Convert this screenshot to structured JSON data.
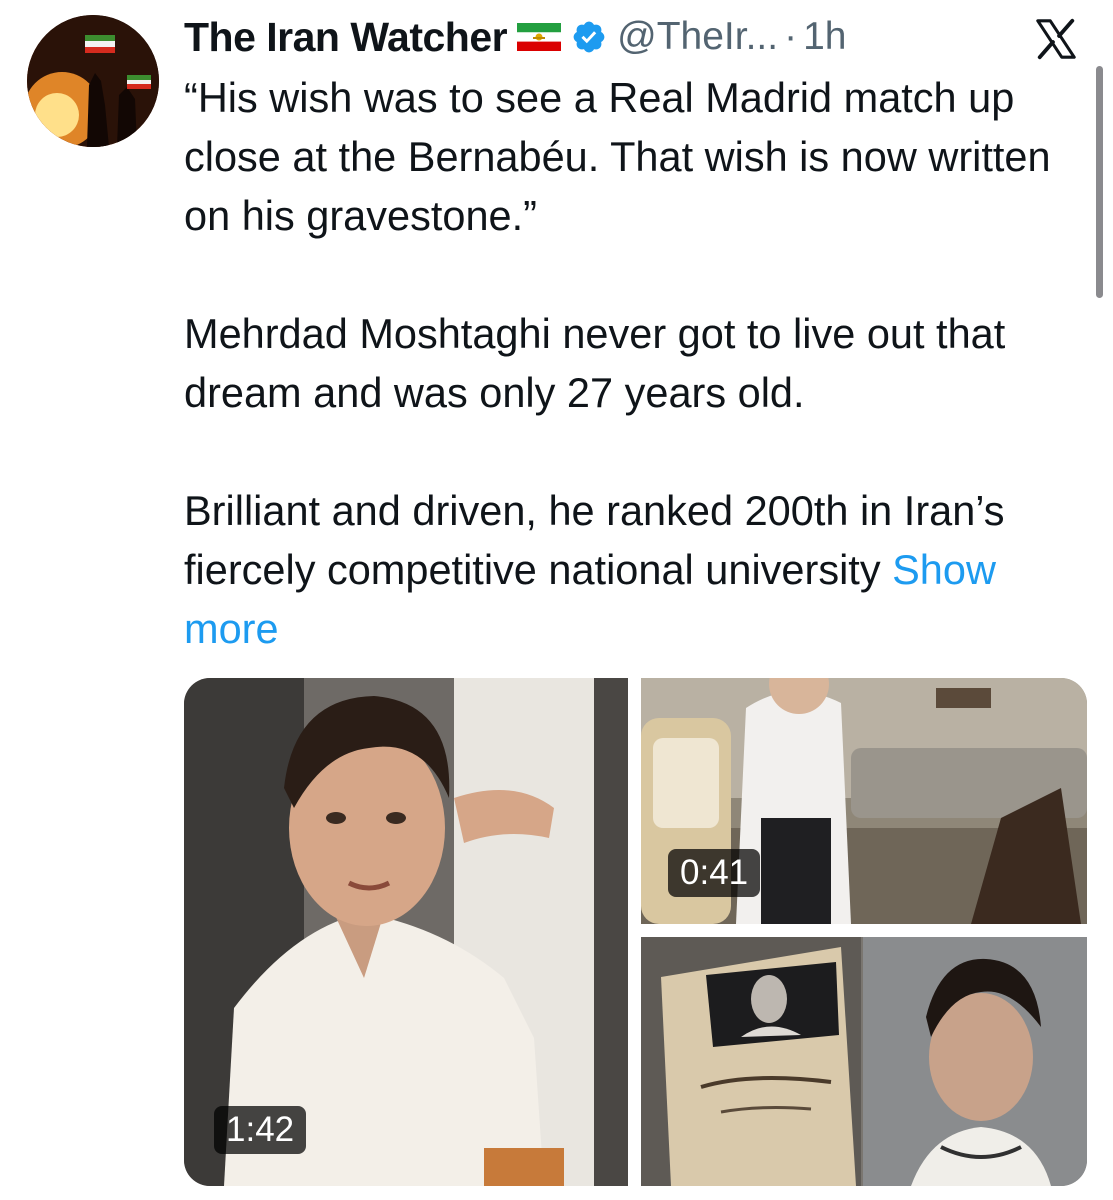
{
  "tweet": {
    "author": {
      "display_name": "The Iran Watcher",
      "handle": "@TheIr...",
      "separator": "·",
      "time": "1h",
      "avatar_icon": "avatar-protest-fire",
      "flag_icon": "iran-lion-sun-flag-icon",
      "verified_icon": "verified-badge-icon"
    },
    "close_icon": "x-logo-icon",
    "paragraphs": [
      "“His wish was to see a Real Madrid match up close at the Bernabéu. That wish is now written on his gravestone.”",
      "Mehrdad Moshtaghi never got to live out that dream and was only 27 years old."
    ],
    "last_paragraph": "Brilliant and driven, he ranked 200th in Iran’s fiercely competitive national university",
    "show_more": "Show more",
    "media": [
      {
        "kind": "video",
        "duration": "1:42"
      },
      {
        "kind": "video",
        "duration": "0:41"
      },
      {
        "kind": "image"
      }
    ],
    "colors": {
      "link": "#1d9bf0",
      "verified": "#1d9bf0",
      "secondary_text": "#536471"
    }
  }
}
